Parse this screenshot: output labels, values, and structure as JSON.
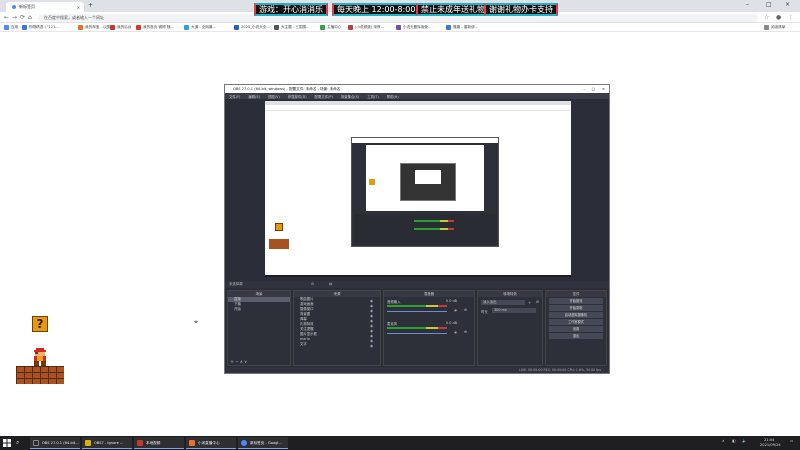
{
  "browser": {
    "tab_title": "新标签页",
    "tab_close": "×",
    "new_tab": "+",
    "window_controls": [
      "–",
      "□",
      "×"
    ],
    "nav": {
      "back": "←",
      "forward": "→",
      "reload": "⟳",
      "home": "⌂"
    },
    "address_placeholder": "在百度中搜索，或者输入一个网址",
    "bookmarks": [
      {
        "label": "应用",
        "color": "#4a8af4"
      },
      {
        "label": "购物精选 | \"121...",
        "color": "#3c78d8"
      },
      {
        "label": "我的淘宝 - 以图...",
        "color": "#e8712a"
      },
      {
        "label": "我的后台",
        "color": "#c0392b"
      },
      {
        "label": "我的首页 微博 随...",
        "color": "#e0372c"
      },
      {
        "label": "大道 - 全网最...",
        "color": "#27a3d9"
      },
      {
        "label": "2020_小说大全...",
        "color": "#2a62b8"
      },
      {
        "label": "大主题 - 三国搜...",
        "color": "#555555"
      },
      {
        "label": "主播中心",
        "color": "#31a24c"
      },
      {
        "label": "(小说频道) 深夜...",
        "color": "#b83d3d"
      },
      {
        "label": "小说无删除版免...",
        "color": "#7a4ca8"
      },
      {
        "label": "雅趣 - 重新使...",
        "color": "#3a7bd5"
      }
    ],
    "reading_list": "阅读清单"
  },
  "banners": [
    "游戏：开心消消乐",
    "每天晚上 12:00-8:00",
    "禁止未成年送礼物",
    "谢谢礼物办卡支持"
  ],
  "mario_box_glyph": "?",
  "obs": {
    "title": "OBS 27.0.1 (64-bit, windows) - 配置文件: 未命名 - 场景: 未命名",
    "menu": [
      "文件(F)",
      "编辑(E)",
      "视图(V)",
      "停靠部件(D)",
      "配置文件(P)",
      "场景集合(S)",
      "工具(T)",
      "帮助(H)"
    ],
    "scene_source_label": "未选择源",
    "docks": {
      "scenes": {
        "title": "场景",
        "items": [
          "直播",
          "下播",
          "开始"
        ]
      },
      "sources": {
        "title": "来源",
        "items": [
          "歌曲图片",
          "游戏画面",
          "摄像窗口",
          "背景图",
          "弹幕",
          "礼物特效",
          "关注提醒",
          "图片显示框",
          "mario",
          "文字"
        ]
      },
      "mixer": {
        "title": "混音器",
        "channels": [
          {
            "name": "音频输入",
            "level": "0.0 dB"
          },
          {
            "name": "麦克风",
            "level": "0.0 dB"
          }
        ]
      },
      "transitions": {
        "title": "转场特效",
        "mode": "淡入淡出",
        "duration_label": "时长",
        "duration": "300 ms"
      },
      "controls": {
        "title": "控件",
        "buttons": [
          "开始推流",
          "开始录制",
          "启动虚拟摄像机",
          "工作室模式",
          "设置",
          "退出"
        ]
      }
    },
    "status": "LIVE: 00:00:00   REC: 00:00:00   CPU: 1.6%, 30.00 fps"
  },
  "taskbar": {
    "tasks": [
      {
        "label": "OBS 27.0.1 (64-bit...",
        "color": "#2b2b2b"
      },
      {
        "label": "OBS7 - Ignore ...",
        "color": "#d8b400"
      },
      {
        "label": "本地视频",
        "color": "#c0392b"
      },
      {
        "label": "小米直播中心",
        "color": "#e8712a"
      },
      {
        "label": "新标签页 - Googl...",
        "color": "#4a8af4"
      }
    ],
    "clock_time": "21:04",
    "clock_date": "2021/09/24"
  }
}
